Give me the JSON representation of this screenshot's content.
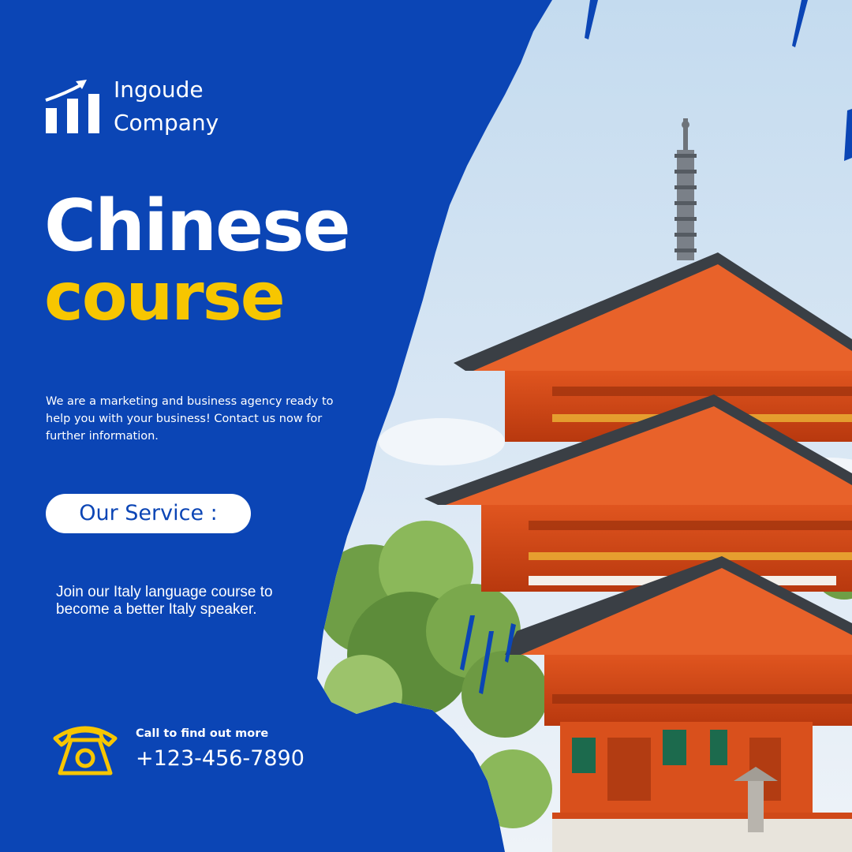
{
  "brand": {
    "name_line1": "Ingoude",
    "name_line2": "Company",
    "logo_icon": "bar-chart-growth-icon"
  },
  "headline": {
    "line1": "Chinese",
    "line2": "course"
  },
  "description": "We are a marketing and business agency ready to help you with your business! Contact us now for further information.",
  "service": {
    "pill_label": "Our Service :",
    "text": "Join our Italy language course to become a better Italy speaker."
  },
  "contact": {
    "label": "Call to find out more",
    "phone": "+123-456-7890",
    "icon": "telephone-icon"
  },
  "colors": {
    "background": "#0b45b5",
    "accent": "#f7c600",
    "text": "#ffffff"
  }
}
